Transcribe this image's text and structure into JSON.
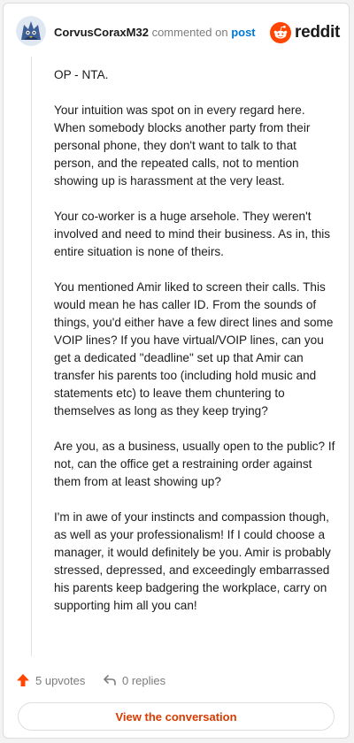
{
  "header": {
    "username": "CorvusCoraxM32",
    "action_text": "commented on",
    "post_link": "post",
    "brand": "reddit"
  },
  "comment": {
    "paragraphs": [
      "OP - NTA.",
      "Your intuition was spot on in every regard here. When somebody blocks another party from their personal phone, they don't want to talk to that person, and the repeated calls, not to mention showing up is harassment at the very least.",
      "Your co-worker is a huge arsehole. They weren't involved and need to mind their business. As in, this entire situation is none of theirs.",
      "You mentioned Amir liked to screen their calls. This would mean he has caller ID. From the sounds of things, you'd either have a few direct lines and some VOIP lines? If you have virtual/VOIP lines, can you get a dedicated \"deadline\" set up that Amir can transfer his parents too (including hold music and statements etc) to leave them chuntering to themselves as long as they keep trying?",
      "Are you, as a business, usually open to the public? If not, can the office get a restraining order against them from at least showing up?",
      "I'm in awe of your instincts and compassion though, as well as your professionalism! If I could choose a manager, it would definitely be you. Amir is probably stressed, depressed, and exceedingly embarrassed his parents keep badgering the workplace, carry on supporting him all you can!"
    ]
  },
  "footer": {
    "upvotes": "5 upvotes",
    "replies": "0 replies",
    "cta": "View the conversation"
  },
  "colors": {
    "accent": "#ff4500",
    "link": "#0079d3",
    "cta_text": "#d93a00"
  }
}
